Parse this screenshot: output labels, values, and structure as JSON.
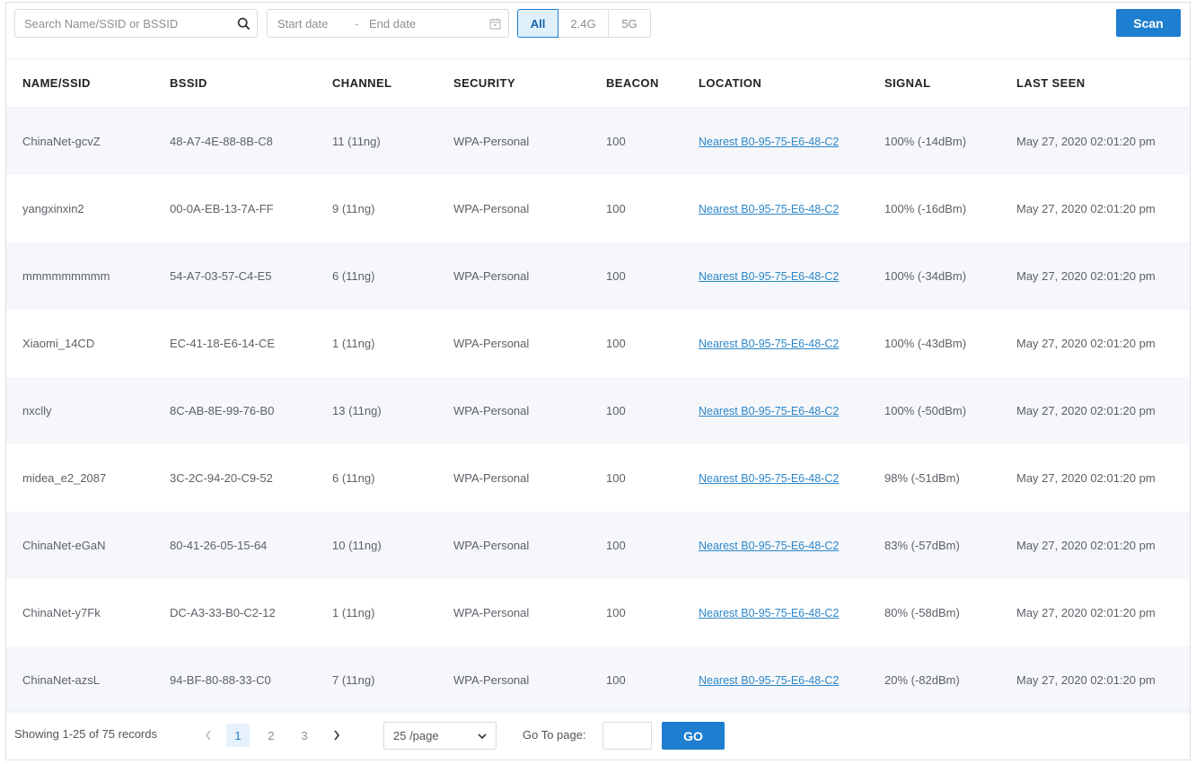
{
  "toolbar": {
    "search_placeholder": "Search Name/SSID or BSSID",
    "start_date_placeholder": "Start date",
    "separator": "-",
    "end_date_placeholder": "End date",
    "bands": [
      {
        "label": "All",
        "active": true
      },
      {
        "label": "2.4G",
        "active": false
      },
      {
        "label": "5G",
        "active": false
      }
    ],
    "scan_label": "Scan",
    "accent_color": "#1e7fd0"
  },
  "table": {
    "columns": [
      "NAME/SSID",
      "BSSID",
      "CHANNEL",
      "SECURITY",
      "BEACON",
      "LOCATION",
      "SIGNAL",
      "LAST SEEN"
    ],
    "rows": [
      {
        "name": "ChinaNet-gcvZ",
        "bssid": "48-A7-4E-88-8B-C8",
        "channel": "11 (11ng)",
        "security": "WPA-Personal",
        "beacon": "100",
        "location": "Nearest B0-95-75-E6-48-C2",
        "signal": "100% (-14dBm)",
        "last_seen": "May 27, 2020 02:01:20 pm"
      },
      {
        "name": "yangxinxin2",
        "bssid": "00-0A-EB-13-7A-FF",
        "channel": "9 (11ng)",
        "security": "WPA-Personal",
        "beacon": "100",
        "location": "Nearest B0-95-75-E6-48-C2",
        "signal": "100% (-16dBm)",
        "last_seen": "May 27, 2020 02:01:20 pm"
      },
      {
        "name": "mmmmmmmmm",
        "bssid": "54-A7-03-57-C4-E5",
        "channel": "6 (11ng)",
        "security": "WPA-Personal",
        "beacon": "100",
        "location": "Nearest B0-95-75-E6-48-C2",
        "signal": "100% (-34dBm)",
        "last_seen": "May 27, 2020 02:01:20 pm"
      },
      {
        "name": "Xiaomi_14CD",
        "bssid": "EC-41-18-E6-14-CE",
        "channel": "1 (11ng)",
        "security": "WPA-Personal",
        "beacon": "100",
        "location": "Nearest B0-95-75-E6-48-C2",
        "signal": "100% (-43dBm)",
        "last_seen": "May 27, 2020 02:01:20 pm"
      },
      {
        "name": "nxclly",
        "bssid": "8C-AB-8E-99-76-B0",
        "channel": "13 (11ng)",
        "security": "WPA-Personal",
        "beacon": "100",
        "location": "Nearest B0-95-75-E6-48-C2",
        "signal": "100% (-50dBm)",
        "last_seen": "May 27, 2020 02:01:20 pm"
      },
      {
        "name": "midea_e2_2087",
        "bssid": "3C-2C-94-20-C9-52",
        "channel": "6 (11ng)",
        "security": "WPA-Personal",
        "beacon": "100",
        "location": "Nearest B0-95-75-E6-48-C2",
        "signal": "98% (-51dBm)",
        "last_seen": "May 27, 2020 02:01:20 pm"
      },
      {
        "name": "ChinaNet-eGaN",
        "bssid": "80-41-26-05-15-64",
        "channel": "10 (11ng)",
        "security": "WPA-Personal",
        "beacon": "100",
        "location": "Nearest B0-95-75-E6-48-C2",
        "signal": "83% (-57dBm)",
        "last_seen": "May 27, 2020 02:01:20 pm"
      },
      {
        "name": "ChinaNet-y7Fk",
        "bssid": "DC-A3-33-B0-C2-12",
        "channel": "1 (11ng)",
        "security": "WPA-Personal",
        "beacon": "100",
        "location": "Nearest B0-95-75-E6-48-C2",
        "signal": "80% (-58dBm)",
        "last_seen": "May 27, 2020 02:01:20 pm"
      },
      {
        "name": "ChinaNet-azsL",
        "bssid": "94-BF-80-88-33-C0",
        "channel": "7 (11ng)",
        "security": "WPA-Personal",
        "beacon": "100",
        "location": "Nearest B0-95-75-E6-48-C2",
        "signal": "20% (-82dBm)",
        "last_seen": "May 27, 2020 02:01:20 pm"
      }
    ]
  },
  "footer": {
    "records_text": "Showing 1-25 of 75 records",
    "pages": [
      "1",
      "2",
      "3"
    ],
    "current_page": "1",
    "page_size": "25 /page",
    "goto_label": "Go To page:",
    "go_label": "GO"
  }
}
